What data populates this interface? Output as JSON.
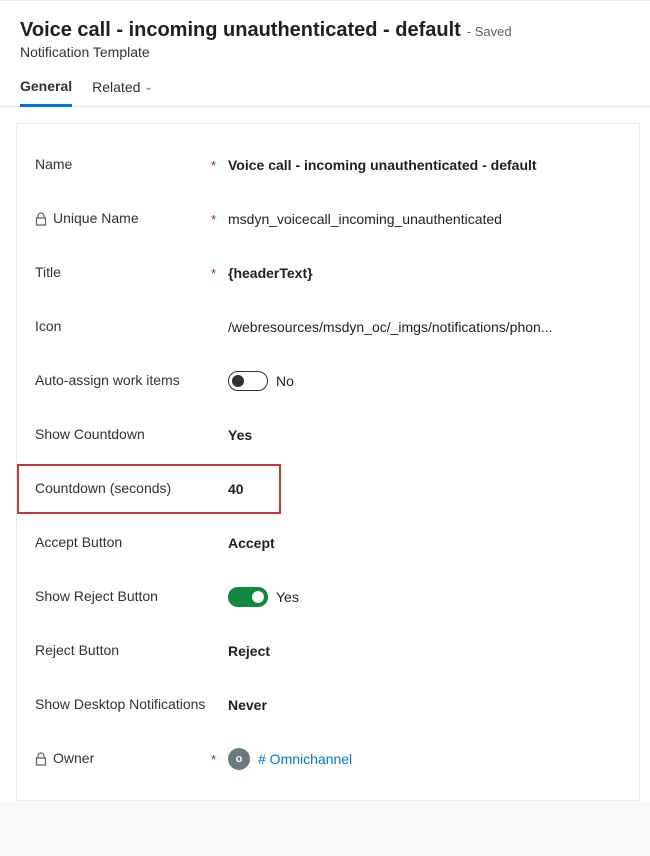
{
  "header": {
    "title": "Voice call - incoming unauthenticated - default",
    "saved": "- Saved",
    "subtitle": "Notification Template"
  },
  "tabs": {
    "general": "General",
    "related": "Related"
  },
  "form": {
    "name": {
      "label": "Name",
      "value": "Voice call - incoming unauthenticated - default"
    },
    "unique_name": {
      "label": "Unique Name",
      "value": "msdyn_voicecall_incoming_unauthenticated"
    },
    "title_field": {
      "label": "Title",
      "value": "{headerText}"
    },
    "icon": {
      "label": "Icon",
      "value": "/webresources/msdyn_oc/_imgs/notifications/phon..."
    },
    "auto_assign": {
      "label": "Auto-assign work items",
      "value": "No"
    },
    "show_countdown": {
      "label": "Show Countdown",
      "value": "Yes"
    },
    "countdown": {
      "label": "Countdown (seconds)",
      "value": "40"
    },
    "accept_button": {
      "label": "Accept Button",
      "value": "Accept"
    },
    "show_reject": {
      "label": "Show Reject Button",
      "value": "Yes"
    },
    "reject_button": {
      "label": "Reject Button",
      "value": "Reject"
    },
    "show_desktop": {
      "label": "Show Desktop Notifications",
      "value": "Never"
    },
    "owner": {
      "label": "Owner",
      "value": "# Omnichannel",
      "initial": "o"
    }
  }
}
